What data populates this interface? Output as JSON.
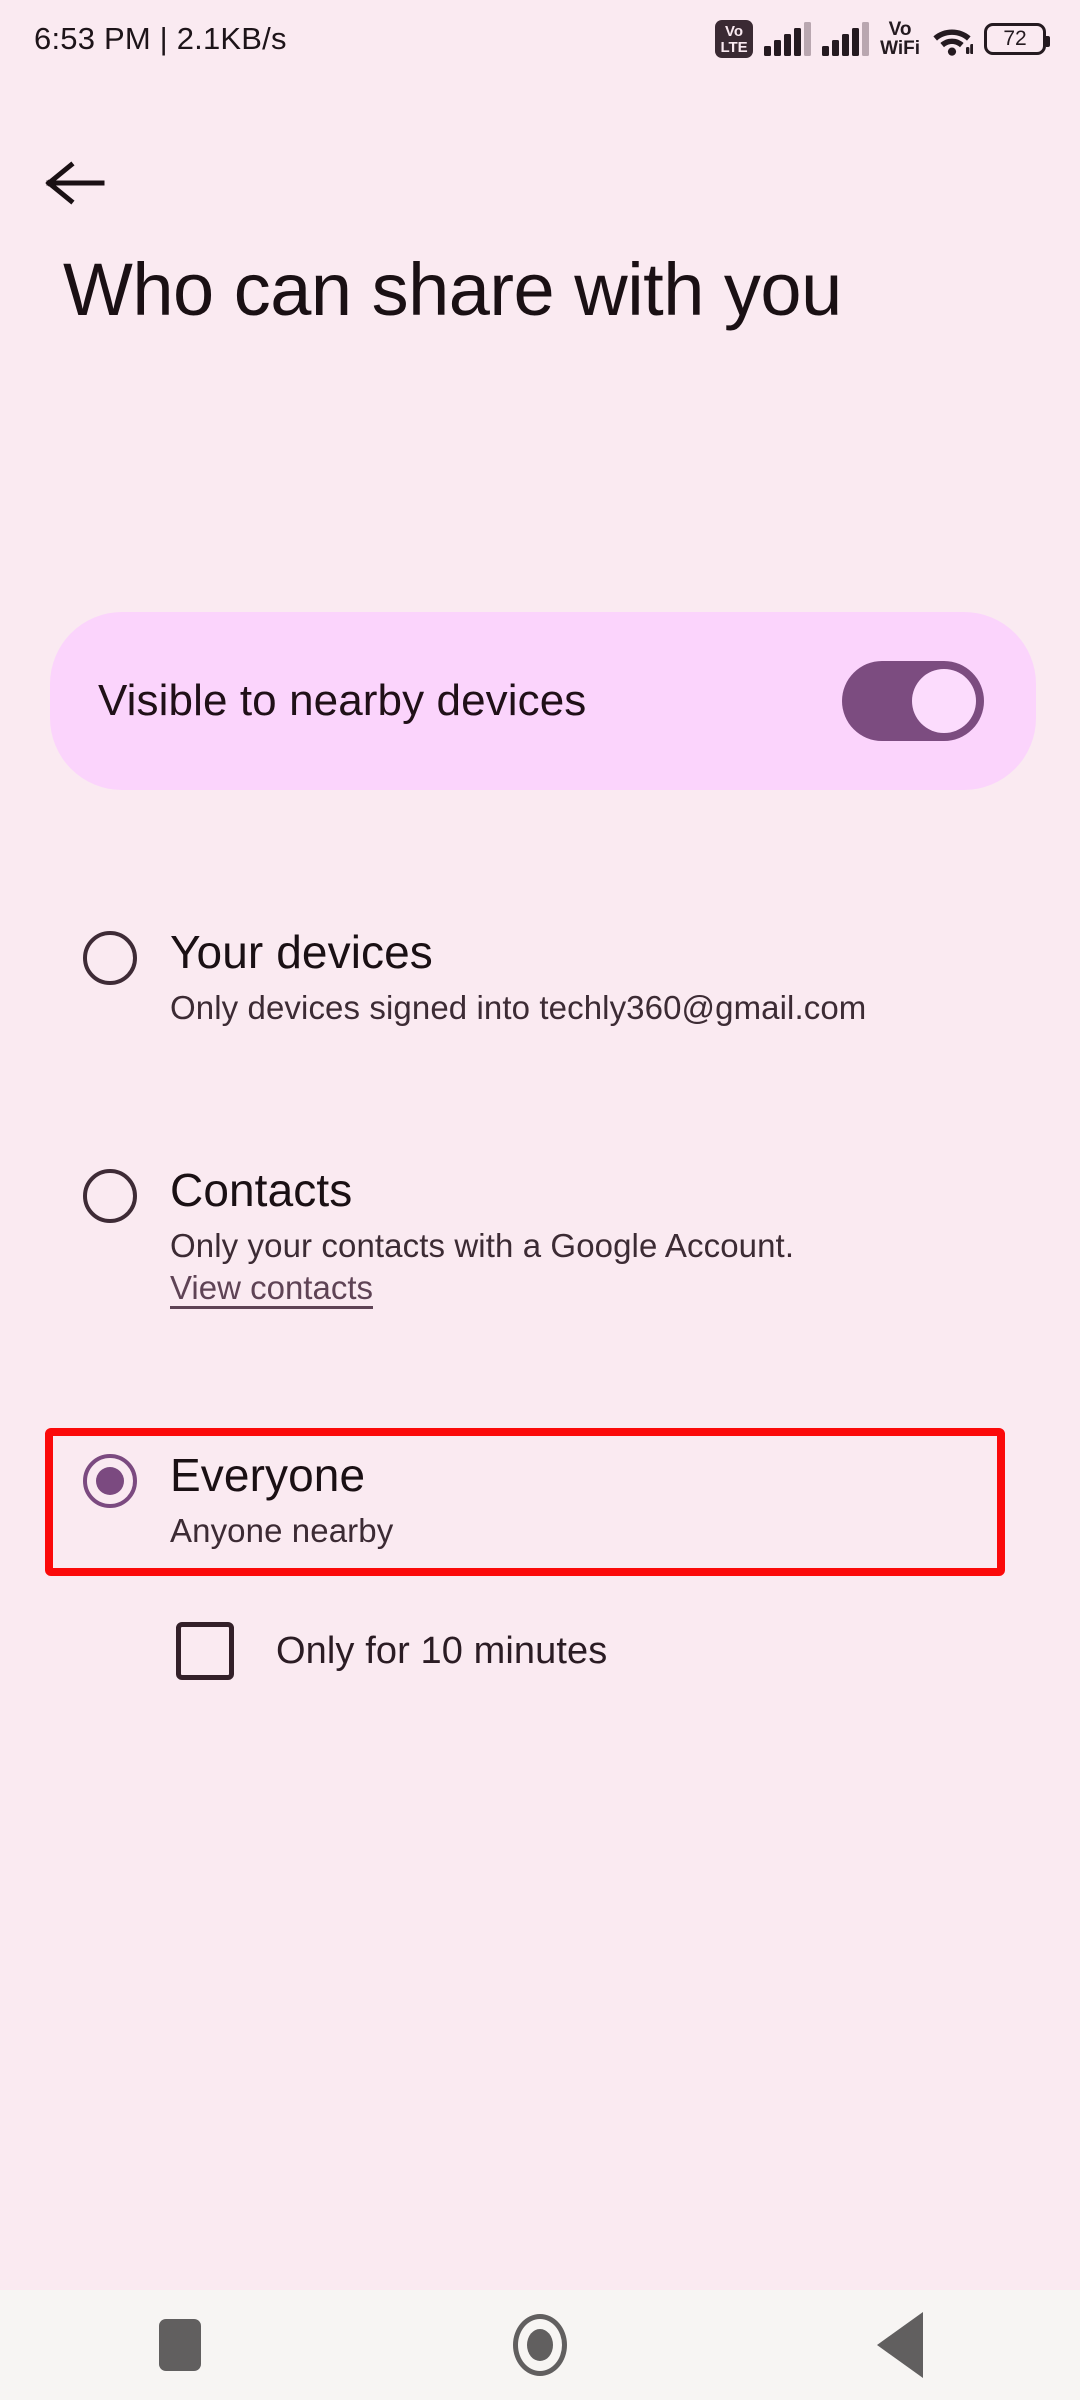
{
  "status_bar": {
    "time_and_speed": "6:53 PM | 2.1KB/s",
    "volte_line1": "Vo",
    "volte_line2": "LTE",
    "vowifi_line1": "Vo",
    "vowifi_line2": "WiFi",
    "battery_percent": "72",
    "signal_bars_1": "4 of 5",
    "signal_bars_2": "4 of 5"
  },
  "appbar": {
    "back_label": "Back"
  },
  "page": {
    "title": "Who can share with you"
  },
  "visible_card": {
    "label": "Visible to nearby devices",
    "toggle_state": "on",
    "track_color": "#7c4c80",
    "thumb_color": "#fcdcfd",
    "card_color": "#fbd4fc"
  },
  "options": [
    {
      "id": "your-devices",
      "title": "Your devices",
      "subtitle": "Only devices signed into techly360@gmail.com",
      "selected": false
    },
    {
      "id": "contacts",
      "title": "Contacts",
      "subtitle": "Only your contacts with a Google Account.",
      "link": "View contacts",
      "selected": false
    },
    {
      "id": "everyone",
      "title": "Everyone",
      "subtitle": "Anyone nearby",
      "selected": true
    }
  ],
  "checkbox": {
    "label": "Only for 10 minutes",
    "checked": false
  },
  "annotation": {
    "color": "#fb0a0a",
    "target": "everyone"
  },
  "navbar": {
    "recents_label": "Recents",
    "home_label": "Home",
    "back_label": "Back"
  },
  "colors": {
    "background": "#faeaf1",
    "accent_purple": "#7b4a80",
    "text_primary": "#1a1014",
    "text_secondary": "#3c2b34",
    "navbar_background": "#f7f5f3"
  }
}
